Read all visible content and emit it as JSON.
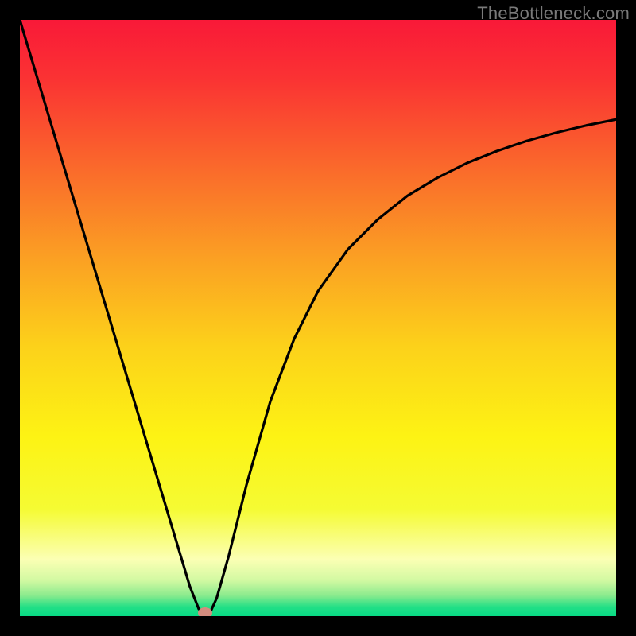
{
  "watermark": "TheBottleneck.com",
  "chart_data": {
    "type": "line",
    "title": "",
    "xlabel": "",
    "ylabel": "",
    "xlim": [
      0,
      100
    ],
    "ylim": [
      0,
      100
    ],
    "grid": false,
    "curve": {
      "x": [
        0,
        3,
        6,
        9,
        12,
        15,
        18,
        21,
        24,
        27,
        28.5,
        30,
        31,
        32,
        33,
        35,
        38,
        42,
        46,
        50,
        55,
        60,
        65,
        70,
        75,
        80,
        85,
        90,
        95,
        100
      ],
      "y": [
        100,
        90,
        80,
        70,
        60,
        50,
        40,
        30,
        20,
        10,
        5,
        1.2,
        0.6,
        0.8,
        3,
        10,
        22,
        36,
        46.5,
        54.5,
        61.5,
        66.5,
        70.5,
        73.5,
        76,
        78,
        79.7,
        81.1,
        82.3,
        83.3
      ]
    },
    "minimum_marker": {
      "x": 31,
      "y": 0.6
    },
    "background_gradient": {
      "stops": [
        {
          "pct": 0,
          "color": "#f91938"
        },
        {
          "pct": 10,
          "color": "#fa3333"
        },
        {
          "pct": 25,
          "color": "#fa6a2b"
        },
        {
          "pct": 40,
          "color": "#fba023"
        },
        {
          "pct": 55,
          "color": "#fcd21a"
        },
        {
          "pct": 70,
          "color": "#fdf314"
        },
        {
          "pct": 82,
          "color": "#f5fb33"
        },
        {
          "pct": 90.5,
          "color": "#fbffb4"
        },
        {
          "pct": 94,
          "color": "#d2f9a2"
        },
        {
          "pct": 96.5,
          "color": "#8ceb8e"
        },
        {
          "pct": 98.5,
          "color": "#22df86"
        },
        {
          "pct": 100,
          "color": "#07db85"
        }
      ]
    }
  }
}
